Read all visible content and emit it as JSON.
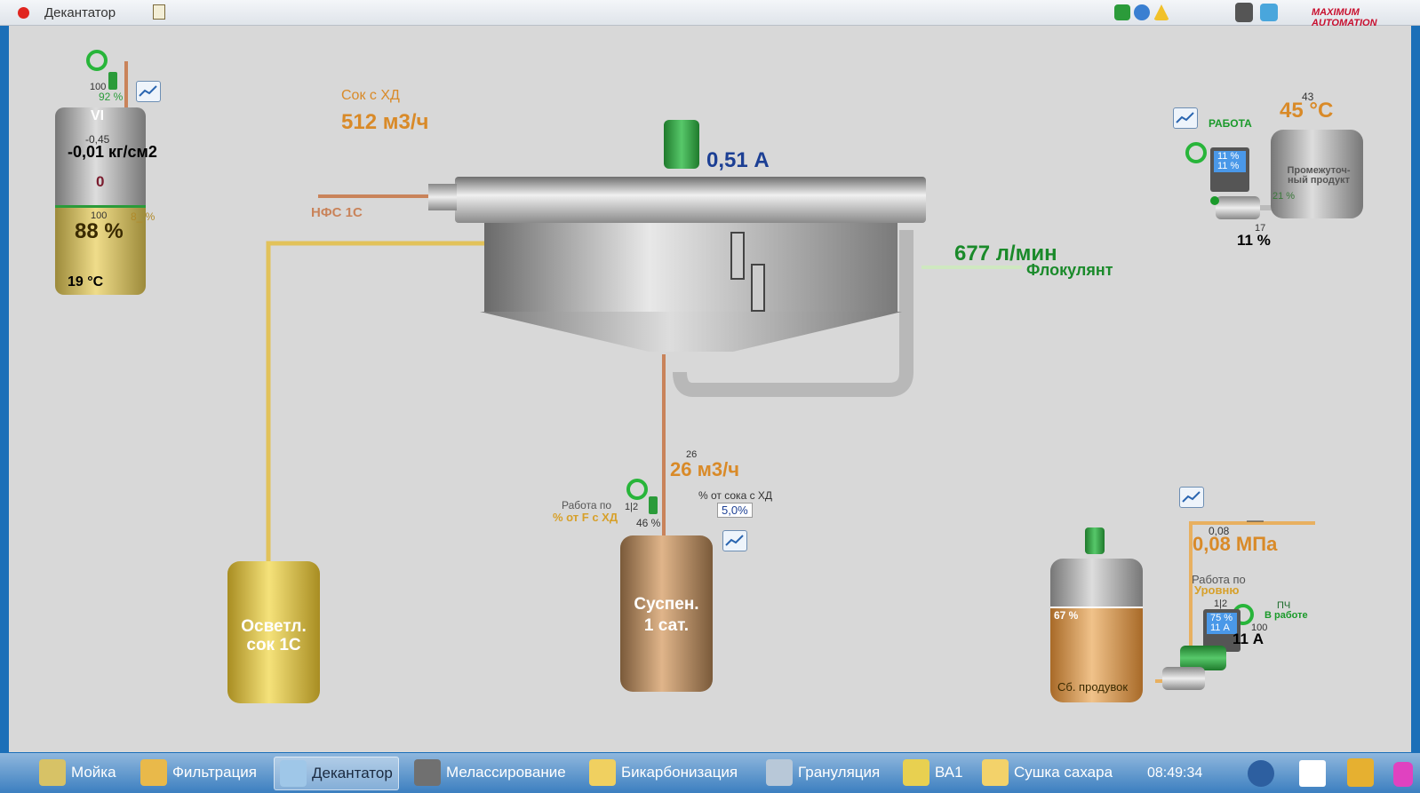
{
  "window": {
    "title": "Декантатор"
  },
  "tank_vi": {
    "name": "VI",
    "pressure_setpoint": "-0,45",
    "pressure": "-0,01 кг/см2",
    "counter": "0",
    "level_max": "100",
    "level_pct": "88 %",
    "level_side": "8_ %",
    "temperature": "19 °C",
    "valve_max": "100",
    "valve_pct": "92 %"
  },
  "juice_xd": {
    "label": "Сок с ХД",
    "flow": "512 м3/ч"
  },
  "nfs_label": "НФС 1С",
  "decanter": {
    "motor_current": "0,51 А"
  },
  "flocculant": {
    "flow": "677 л/мин",
    "label": "Флокулянт"
  },
  "intermediate": {
    "status": "РАБОТА",
    "temp_setpoint": "43",
    "temp": "45 °C",
    "tank_label": "Промежуточ-ный продукт",
    "pump_pct": "11 %",
    "pump_current": "11 %",
    "level_pct": "21 %",
    "speed_setpoint": "17",
    "speed": "11 %"
  },
  "suspension_line": {
    "flow_setpoint": "26",
    "flow": "26 м3/ч",
    "mode_label_1": "Работа по",
    "mode_label_2": "% от F с ХД",
    "valve_pos": "1|2",
    "valve_pct": "46 %",
    "ratio_label": "% от сока с ХД",
    "ratio_value": "5,0%"
  },
  "tanks": {
    "clarified": "Осветл. сок 1С",
    "suspension": "Суспен. 1 сат."
  },
  "collector": {
    "pressure_setpoint": "0,08",
    "pressure": "0,08 МПа",
    "mode_label_1": "Работа по",
    "mode_label_2": "Уровню",
    "pos": "1|2",
    "vfd_label": "ПЧ",
    "vfd_status": "В работе",
    "pump_pct": "75 %",
    "pump_current": "11 А",
    "current_max": "100",
    "current": "11 А",
    "level_pct": "67 %",
    "tank_label": "Сб. продувок"
  },
  "taskbar": {
    "items": [
      "Мойка",
      "Фильтрация",
      "Декантатор",
      "Мелассирование",
      "Бикарбонизация",
      "Грануляция",
      "ВА1",
      "Сушка сахара"
    ],
    "clock": "08:49:34"
  },
  "logo": "MAXIMUM AUTOMATION",
  "colors": {
    "orange": "#d98a28",
    "green": "#1a8a2a",
    "blue": "#1c3f94",
    "pipe_yellow": "#e2c25a",
    "pipe_copper": "#c9835a"
  }
}
